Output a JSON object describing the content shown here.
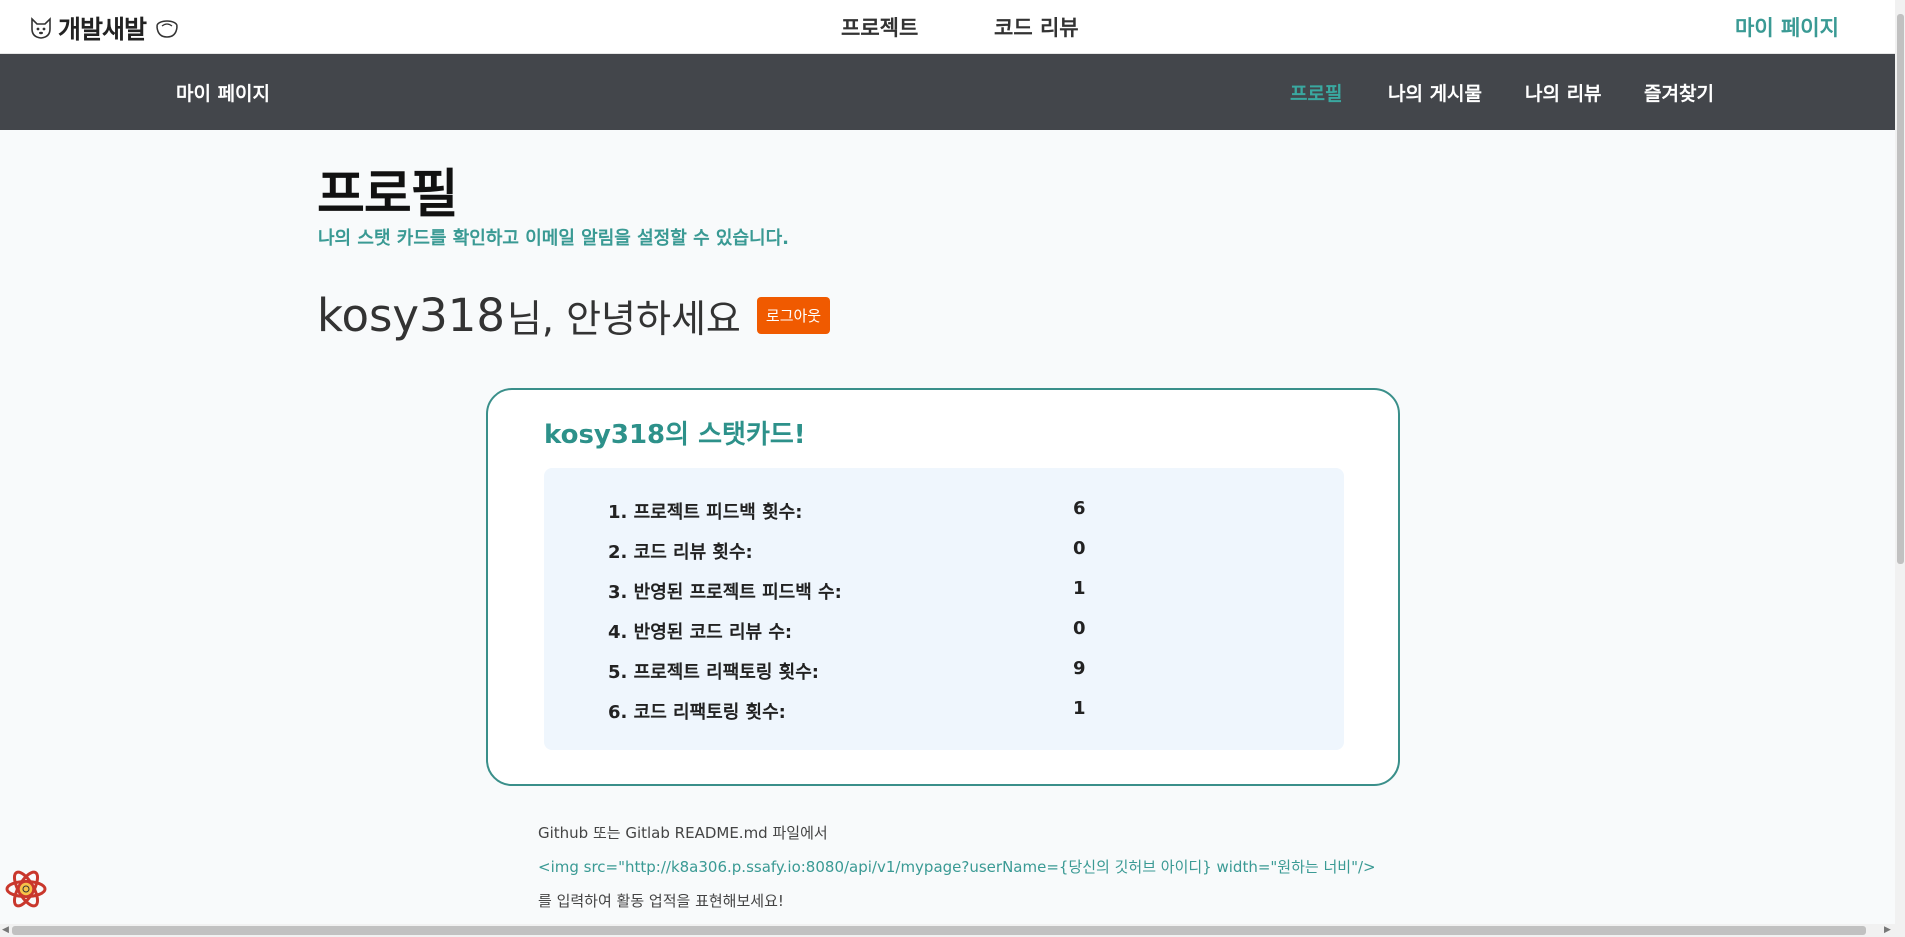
{
  "header": {
    "logo_text": "개발새발",
    "nav": [
      {
        "label": "프로젝트"
      },
      {
        "label": "코드 리뷰"
      }
    ],
    "mypage": "마이 페이지"
  },
  "subnav": {
    "title": "마이 페이지",
    "items": [
      {
        "label": "프로필",
        "active": true
      },
      {
        "label": "나의 게시물"
      },
      {
        "label": "나의 리뷰"
      },
      {
        "label": "즐겨찾기"
      }
    ]
  },
  "profile": {
    "title": "프로필",
    "subtitle": "나의 스탯 카드를 확인하고 이메일 알림을 설정할 수 있습니다.",
    "username": "kosy318",
    "greeting_suffix": "님, 안녕하세요",
    "logout": "로그아웃"
  },
  "stat_card": {
    "username": "kosy318",
    "title_suffix": "의 스탯카드!",
    "rows": [
      {
        "label": "1. 프로젝트 피드백 횟수:",
        "value": "6"
      },
      {
        "label": "2. 코드 리뷰 횟수:",
        "value": "0"
      },
      {
        "label": "3. 반영된 프로젝트 피드백 수:",
        "value": "1"
      },
      {
        "label": "4. 반영된 코드 리뷰 수:",
        "value": "0"
      },
      {
        "label": "5. 프로젝트 리팩토링 횟수:",
        "value": "9"
      },
      {
        "label": "6. 코드 리팩토링 횟수:",
        "value": "1"
      }
    ]
  },
  "readme": {
    "line1": "Github 또는 Gitlab README.md 파일에서",
    "code": "<img src=\"http://k8a306.p.ssafy.io:8080/api/v1/mypage?userName={당신의 깃허브 아이디} width=\"원하는 너비\"/>",
    "line3": "를 입력하여 활동 업적을 표현해보세요!"
  },
  "colors": {
    "accent": "#3a9a94",
    "subnav_bg": "#43464b",
    "logout_bg": "#f05a00",
    "stat_bg": "#eff6fd"
  },
  "icons": [
    "dog-logo-icon",
    "bowl-icon",
    "react-icon"
  ]
}
